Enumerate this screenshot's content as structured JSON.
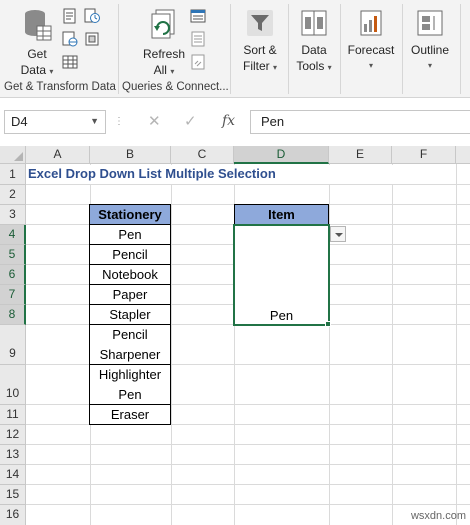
{
  "ribbon": {
    "get_data": {
      "line1": "Get",
      "line2": "Data"
    },
    "refresh_all": {
      "line1": "Refresh",
      "line2": "All"
    },
    "sort_filter": {
      "line1": "Sort &",
      "line2": "Filter"
    },
    "data_tools": {
      "line1": "Data",
      "line2": "Tools"
    },
    "forecast": {
      "line1": "Forecast"
    },
    "outline": {
      "line1": "Outline"
    },
    "groups": {
      "get_transform": "Get & Transform Data",
      "queries": "Queries & Connect..."
    }
  },
  "formula_bar": {
    "name_box": "D4",
    "fx": "fx",
    "value": "Pen"
  },
  "grid": {
    "columns": [
      "A",
      "B",
      "C",
      "D",
      "E",
      "F"
    ],
    "rows": [
      "1",
      "2",
      "3",
      "4",
      "5",
      "6",
      "7",
      "8",
      "9",
      "10",
      "11",
      "12",
      "13",
      "14",
      "15",
      "16"
    ],
    "title": "Excel Drop Down List Multiple Selection",
    "stationery_header": "Stationery",
    "stationery": {
      "r4": "Pen",
      "r5": "Pencil",
      "r6": "Notebook",
      "r7": "Paper",
      "r8": "Stapler",
      "r9a": "Pencil",
      "r9b": "Sharpener",
      "r10a": "Highlighter",
      "r10b": "Pen",
      "r11": "Eraser"
    },
    "item_header": "Item",
    "item_value": "Pen"
  },
  "watermark": "wsxdn.com",
  "colors": {
    "accent": "#217346",
    "header_fill": "#8ea9db",
    "title_text": "#2f4f8f"
  }
}
